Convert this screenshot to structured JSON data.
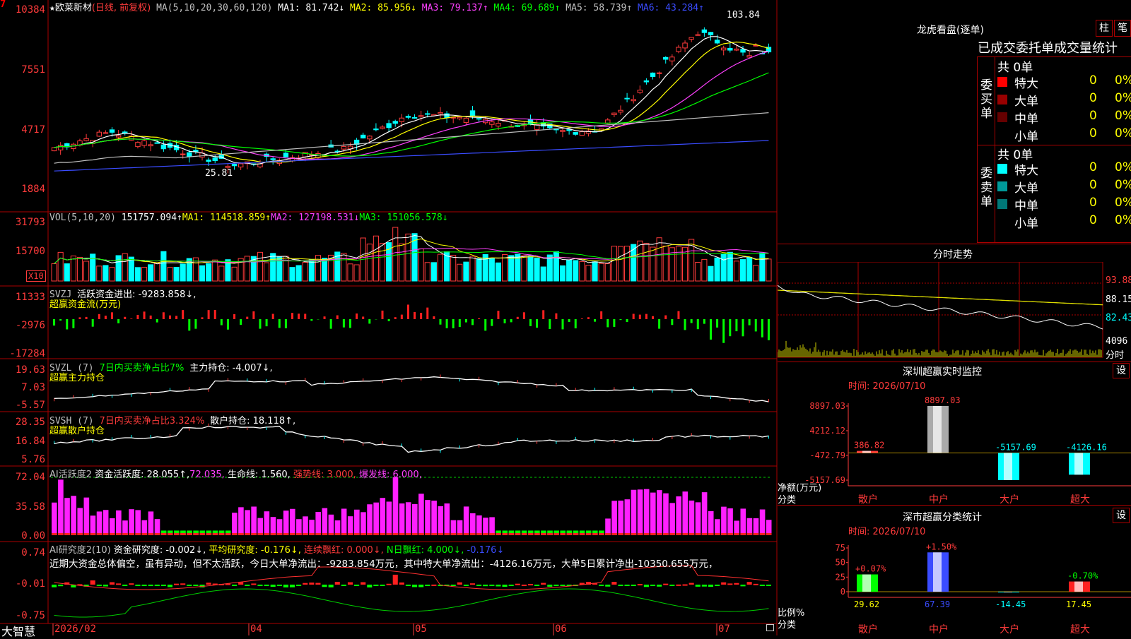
{
  "stock": {
    "name": "欧莱新材",
    "period": "(日线, 前复权)",
    "star": "★",
    "seven": "7"
  },
  "kline": {
    "ma_header": "MA(5,10,20,30,60,120)",
    "ma": [
      {
        "label": "MA1: 81.742↓",
        "color": "#ffffff"
      },
      {
        "label": "MA2: 85.956↓",
        "color": "#ffff00"
      },
      {
        "label": "MA3: 79.137↑",
        "color": "#ff40ff"
      },
      {
        "label": "MA4: 69.689↑",
        "color": "#00ff00"
      },
      {
        "label": "MA5: 58.739↑",
        "color": "#c0c0c0"
      },
      {
        "label": "MA6: 43.284↑",
        "color": "#3a4cff"
      }
    ],
    "y_labels": [
      "10384",
      "7551",
      "4717",
      "1884"
    ],
    "high_label": "103.84",
    "low_label": "25.81"
  },
  "vol": {
    "header": "VOL(5,10,20)",
    "value": "151757.094↑",
    "ma1": "MA1: 114518.859↑",
    "ma2": "MA2: 127198.531↓",
    "ma3": "MA3: 151056.578↓",
    "y_labels": [
      "31793",
      "15700"
    ],
    "unit": "X10"
  },
  "svzj": {
    "header": "SVZJ",
    "text": "活跃资金进出: -9283.858↓,",
    "sub": "超赢资金流(万元)",
    "y_labels": [
      "11333",
      "-2976",
      "-17284"
    ]
  },
  "svzl": {
    "header": "SVZL (7)",
    "ratio": "7日内买卖净占比7%",
    "hold": "主力持仓: -4.007↓,",
    "sub": "超赢主力持仓",
    "y_labels": [
      "19.63",
      "7.03",
      "-5.57"
    ]
  },
  "svsh": {
    "header": "SVSH (7)",
    "ratio": "7日内买卖净占比3.324%",
    "hold": "散户持仓: 18.118↑,",
    "sub": "超赢散户持仓",
    "y_labels": [
      "28.35",
      "16.84",
      "5.76"
    ]
  },
  "ai1": {
    "header": "AI活跃度2",
    "active": "资金活跃度: 28.055↑,",
    "v2": "72.035,",
    "life": "生命线: 1.560,",
    "strong": "强势线: 3.000,",
    "burst": "爆发线: 6.000,",
    "y_labels": [
      "72.04",
      "35.58",
      "0.00"
    ]
  },
  "ai2": {
    "header": "AI研究度2(10)",
    "research": "资金研究度: -0.002↓,",
    "avg": "平均研究度: -0.176↓,",
    "red": "连续飘红: 0.000↓,",
    "nred": "N日飘红: 4.000↓,",
    "last": "-0.176↓",
    "y_labels": [
      "0.74",
      "-0.01",
      "-0.75"
    ],
    "comment": "近期大资金总体偏空，虽有异动，但不太活跃，今日大单净流出：-9283.854万元，其中特大单净流出：-4126.16万元，大单5日累计净出-10350.655万元，"
  },
  "xaxis": {
    "brand": "大智慧",
    "labels": [
      "2026/02",
      "04",
      "05",
      "06",
      "07"
    ]
  },
  "lhb": {
    "title": "龙虎看盘(逐单)",
    "btn1": "柱",
    "btn2": "笔",
    "subtitle": "已成交委托单成交量统计",
    "buy": {
      "label": "委买单",
      "total": "共 0单",
      "rows": [
        {
          "name": "特大",
          "count": "0",
          "pct": "0%",
          "color": "#ff0000"
        },
        {
          "name": "大单",
          "count": "0",
          "pct": "0%",
          "color": "#990000"
        },
        {
          "name": "中单",
          "count": "0",
          "pct": "0%",
          "color": "#660000"
        },
        {
          "name": "小单",
          "count": "0",
          "pct": "0%",
          "color": "#000000"
        }
      ]
    },
    "sell": {
      "label": "委卖单",
      "total": "共 0单",
      "rows": [
        {
          "name": "特大",
          "count": "0",
          "pct": "0%",
          "color": "#00ffff"
        },
        {
          "name": "大单",
          "count": "0",
          "pct": "0%",
          "color": "#009999"
        },
        {
          "name": "中单",
          "count": "0",
          "pct": "0%",
          "color": "#007777"
        },
        {
          "name": "小单",
          "count": "0",
          "pct": "0%",
          "color": "#000000"
        }
      ]
    }
  },
  "intraday": {
    "title": "分时走势",
    "y_labels": [
      "93.88",
      "88.15",
      "82.43",
      "4096",
      "分时"
    ]
  },
  "monitor": {
    "title": "深圳超赢实时监控",
    "btn": "设",
    "time": "时间: 2026/07/10",
    "ylabel": "净额(万元)",
    "xlabel": "分类",
    "y_labels": [
      "8897.03",
      "4212.12",
      "-472.79",
      "-5157.69"
    ],
    "chart_data": {
      "type": "bar",
      "categories": [
        "散户",
        "中户",
        "大户",
        "超大"
      ],
      "values": [
        386.82,
        8897.03,
        -5157.69,
        -4126.16
      ],
      "labels": [
        "386.82",
        "8897.03",
        "-5157.69",
        "-4126.16"
      ],
      "ylim": [
        -5157.69,
        8897.03
      ]
    }
  },
  "stats": {
    "title": "深市超赢分类统计",
    "btn": "设",
    "time": "时间: 2026/07/10",
    "ylabel": "比例%",
    "xlabel": "分类",
    "y_labels": [
      "75",
      "50",
      "25",
      "0"
    ],
    "top_labels": [
      "+0.07%",
      "+1.50%",
      "",
      "-0.70%"
    ],
    "chart_data": {
      "type": "bar",
      "categories": [
        "散户",
        "中户",
        "大户",
        "超大"
      ],
      "values": [
        29.62,
        67.39,
        -14.45,
        17.45
      ],
      "labels": [
        "29.62",
        "67.39",
        "-14.45",
        "17.45"
      ],
      "ylim": [
        0,
        75
      ]
    }
  }
}
